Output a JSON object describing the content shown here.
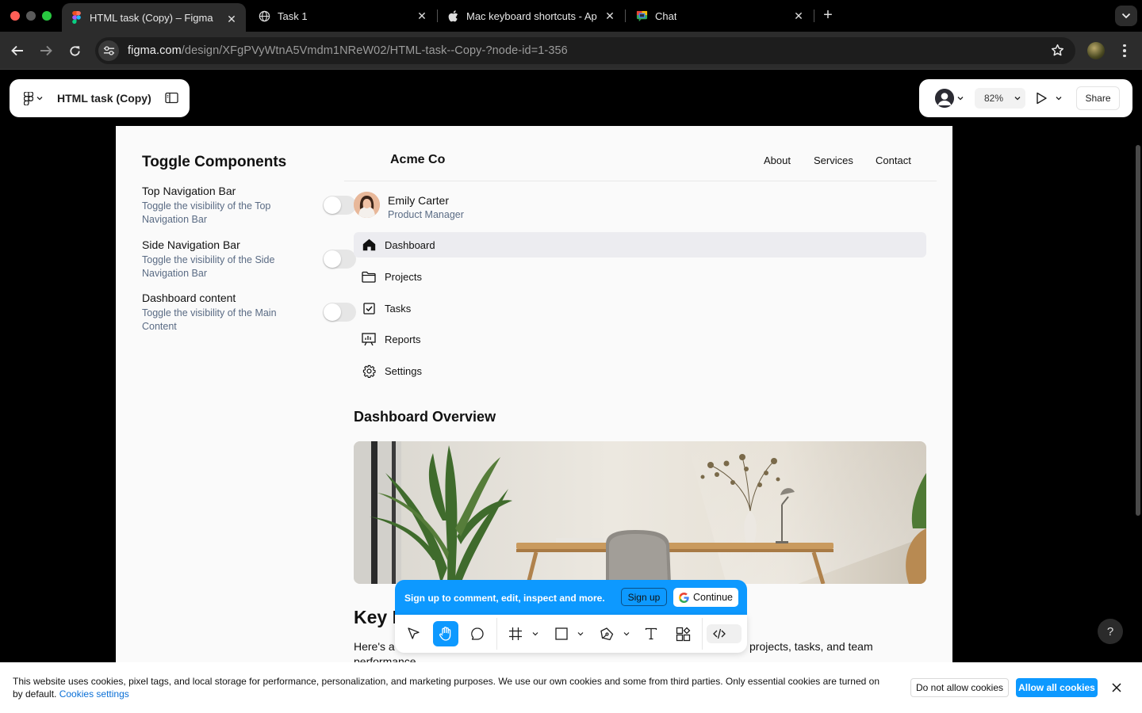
{
  "browser": {
    "tabs": [
      {
        "title": "HTML task (Copy) – Figma",
        "active": true,
        "icon": "figma-icon"
      },
      {
        "title": "Task 1",
        "active": false,
        "icon": "globe-icon"
      },
      {
        "title": "Mac keyboard shortcuts - Apple",
        "active": false,
        "icon": "apple-icon"
      },
      {
        "title": "Chat",
        "active": false,
        "icon": "google-chat-icon"
      }
    ],
    "url_host": "figma.com",
    "url_path": "/design/XFgPVyWtnA5Vmdm1NReW02/HTML-task--Copy-?node-id=1-356"
  },
  "figma": {
    "file_name": "HTML task (Copy)",
    "zoom": "82%",
    "share_label": "Share",
    "signup_text": "Sign up to comment, edit, inspect and more.",
    "signup_button": "Sign up",
    "continue_button": "Continue",
    "help_label": "?",
    "accent": "#0d99ff"
  },
  "design": {
    "toggle_title": "Toggle Components",
    "toggles": [
      {
        "title": "Top Navigation Bar",
        "desc": "Toggle the visibility of the Top Navigation Bar",
        "on": false
      },
      {
        "title": "Side Navigation Bar",
        "desc": "Toggle the visibility of the Side Navigation Bar",
        "on": false
      },
      {
        "title": "Dashboard content",
        "desc": "Toggle the visibility of the Main Content",
        "on": false
      }
    ],
    "brand": "Acme Co",
    "nav": [
      "About",
      "Services",
      "Contact"
    ],
    "user": {
      "name": "Emily Carter",
      "role": "Product Manager"
    },
    "sidebar": [
      {
        "label": "Dashboard",
        "icon": "home-icon",
        "active": true
      },
      {
        "label": "Projects",
        "icon": "folder-icon",
        "active": false
      },
      {
        "label": "Tasks",
        "icon": "checkbox-icon",
        "active": false
      },
      {
        "label": "Reports",
        "icon": "presentation-chart-icon",
        "active": false
      },
      {
        "label": "Settings",
        "icon": "gear-icon",
        "active": false
      }
    ],
    "overview_title": "Dashboard Overview",
    "key_title": "Key I",
    "key_text_start": "Here's a",
    "key_text_end": "projects, tasks, and team",
    "key_text_line2": "performance"
  },
  "cookie": {
    "text": "This website uses cookies, pixel tags, and local storage for performance, personalization, and marketing purposes. We use our own cookies and some from third parties. Only essential cookies are turned on by default.",
    "settings_link": "Cookies settings",
    "deny": "Do not allow cookies",
    "allow": "Allow all cookies"
  }
}
